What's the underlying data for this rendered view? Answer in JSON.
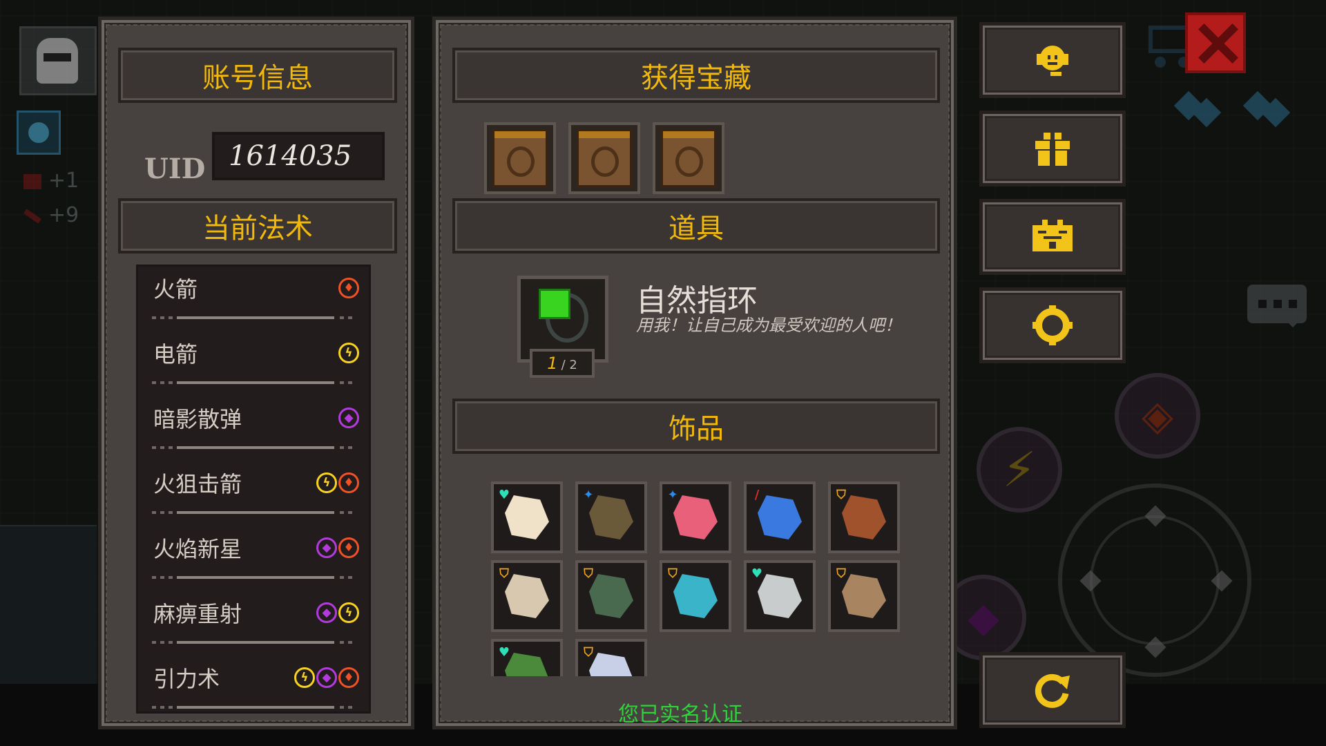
{
  "account_panel": {
    "title": "账号信息",
    "uid_label": "UID",
    "uid_value": "1614035",
    "spells_title": "当前法术",
    "spells": [
      {
        "name": "火箭",
        "elements": [
          "fire"
        ]
      },
      {
        "name": "电箭",
        "elements": [
          "electric"
        ]
      },
      {
        "name": "暗影散弹",
        "elements": [
          "shadow"
        ]
      },
      {
        "name": "火狙击箭",
        "elements": [
          "electric",
          "fire"
        ]
      },
      {
        "name": "火焰新星",
        "elements": [
          "shadow",
          "fire"
        ]
      },
      {
        "name": "麻痹重射",
        "elements": [
          "shadow",
          "electric"
        ]
      },
      {
        "name": "引力术",
        "elements": [
          "electric",
          "shadow",
          "fire"
        ]
      }
    ]
  },
  "treasure_panel": {
    "title": "获得宝藏",
    "treasures": [
      "treasure-chest-icon",
      "treasure-chest-icon",
      "treasure-chest-icon"
    ],
    "items_title": "道具",
    "item": {
      "name": "自然指环",
      "description": "用我！让自己成为最受欢迎的人吧！",
      "count_current": "1",
      "count_total": "/ 2",
      "icon": "nature-ring-icon"
    },
    "accessories_title": "饰品",
    "accessories": [
      {
        "icon": "horn-icon",
        "badge": "heart"
      },
      {
        "icon": "necklace-icon",
        "badge": "star"
      },
      {
        "icon": "meat-icon",
        "badge": "star"
      },
      {
        "icon": "blue-blade-icon",
        "badge": "sword"
      },
      {
        "icon": "boot-icon",
        "badge": "shield"
      },
      {
        "icon": "armor-icon",
        "badge": "shield"
      },
      {
        "icon": "green-glove-icon",
        "badge": "shield"
      },
      {
        "icon": "teal-boot-icon",
        "badge": "shield"
      },
      {
        "icon": "silver-helmet-icon",
        "badge": "heart"
      },
      {
        "icon": "leather-glove-icon",
        "badge": "shield"
      },
      {
        "icon": "leaf-icon",
        "badge": "heart"
      },
      {
        "icon": "arch-icon",
        "badge": "shield"
      }
    ],
    "verified_text": "您已实名认证"
  },
  "side_menu": [
    {
      "name": "support",
      "icon": "headset-icon"
    },
    {
      "name": "gift",
      "icon": "gift-icon"
    },
    {
      "name": "achievements",
      "icon": "calendar-icon"
    },
    {
      "name": "settings",
      "icon": "gear-icon"
    },
    {
      "name": "refresh",
      "icon": "refresh-icon"
    }
  ],
  "background": {
    "stat_health": "+1",
    "stat_attack": "+9"
  },
  "colors": {
    "title_gold": "#f2b90c",
    "verified_green": "#2fd43a",
    "fire": "#f05226",
    "electric": "#f7d21e",
    "shadow": "#b33bde",
    "close_red": "#b41c1c"
  }
}
